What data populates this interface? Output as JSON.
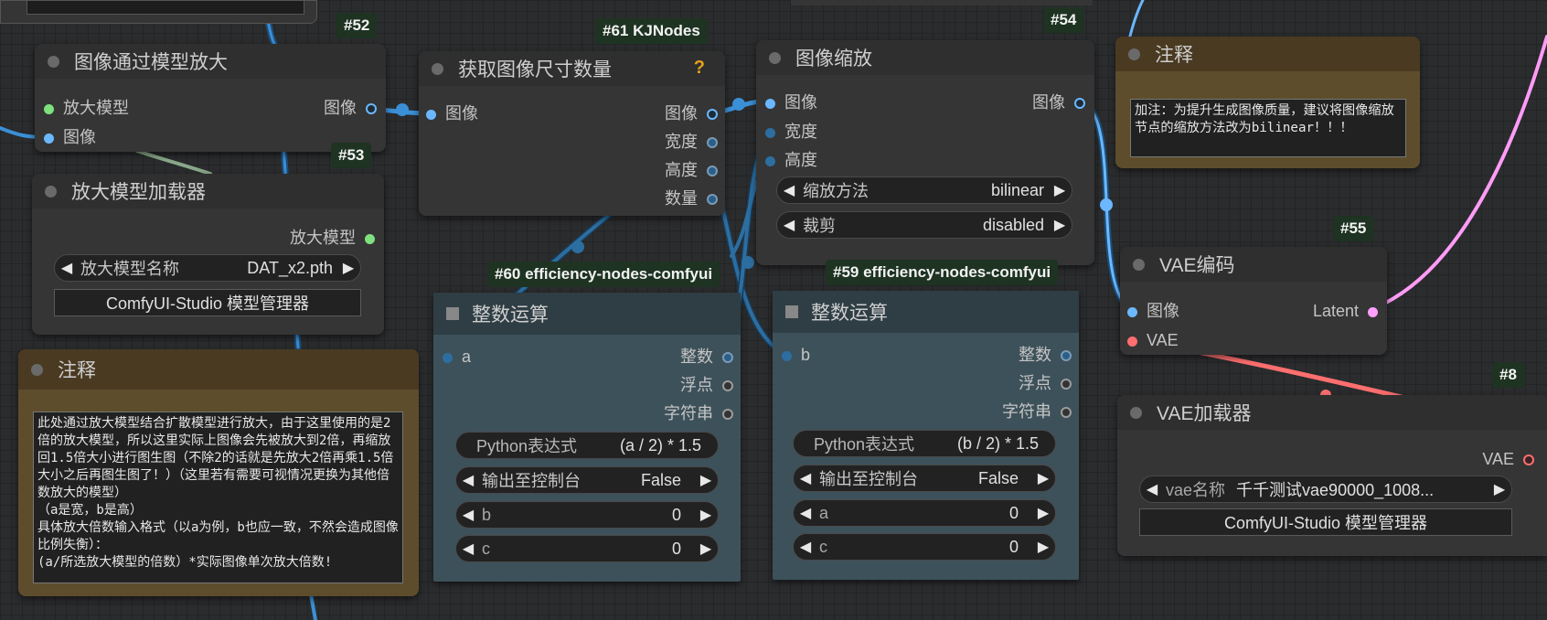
{
  "nodes": {
    "upscale_with_model": {
      "badge": "#52",
      "title": "图像通过模型放大",
      "inputs": [
        "放大模型",
        "图像"
      ],
      "outputs": [
        "图像"
      ]
    },
    "upscale_loader": {
      "badge": "#53",
      "title": "放大模型加载器",
      "outputs": [
        "放大模型"
      ],
      "widget_label": "放大模型名称",
      "widget_value": "DAT_x2.pth",
      "button": "ComfyUI-Studio 模型管理器"
    },
    "get_image_size": {
      "badge": "#61 KJNodes",
      "title": "获取图像尺寸数量",
      "help": "?",
      "inputs": [
        "图像"
      ],
      "outputs": [
        "图像",
        "宽度",
        "高度",
        "数量"
      ]
    },
    "image_scale": {
      "badge": "#54",
      "title": "图像缩放",
      "inputs": [
        "图像",
        "宽度",
        "高度"
      ],
      "outputs": [
        "图像"
      ],
      "widgets": [
        {
          "label": "缩放方法",
          "value": "bilinear"
        },
        {
          "label": "裁剪",
          "value": "disabled"
        }
      ]
    },
    "note_right": {
      "title": "注释",
      "text": "加注：为提升生成图像质量，建议将图像缩放节点的缩放方法改为bilinear！！！"
    },
    "vae_encode": {
      "badge": "#55",
      "title": "VAE编码",
      "inputs": [
        "图像",
        "VAE"
      ],
      "outputs": [
        "Latent"
      ]
    },
    "vae_loader": {
      "badge": "#8",
      "title": "VAE加载器",
      "outputs": [
        "VAE"
      ],
      "widget_label": "vae名称",
      "widget_value": "千千测试vae90000_1008...",
      "button": "ComfyUI-Studio 模型管理器"
    },
    "int_math_a": {
      "badge": "#60 efficiency-nodes-comfyui",
      "title": "整数运算",
      "inputs": [
        "a"
      ],
      "outputs": [
        "整数",
        "浮点",
        "字符串"
      ],
      "expr_label": "Python表达式",
      "expr_value": "(a / 2) * 1.5",
      "widgets": [
        {
          "label": "输出至控制台",
          "value": "False"
        },
        {
          "label": "b",
          "value": "0"
        },
        {
          "label": "c",
          "value": "0"
        }
      ]
    },
    "int_math_b": {
      "badge": "#59 efficiency-nodes-comfyui",
      "title": "整数运算",
      "inputs": [
        "b"
      ],
      "outputs": [
        "整数",
        "浮点",
        "字符串"
      ],
      "expr_label": "Python表达式",
      "expr_value": "(b / 2) * 1.5",
      "widgets": [
        {
          "label": "输出至控制台",
          "value": "False"
        },
        {
          "label": "a",
          "value": "0"
        },
        {
          "label": "c",
          "value": "0"
        }
      ]
    },
    "note_left": {
      "title": "注释",
      "text": "此处通过放大模型结合扩散模型进行放大，由于这里使用的是2倍的放大模型，所以这里实际上图像会先被放大到2倍，再缩放回1.5倍大小进行图生图（不除2的话就是先放大2倍再乘1.5倍大小之后再图生图了！）（这里若有需要可视情况更换为其他倍数放大的模型）\n（a是宽，b是高）\n具体放大倍数输入格式（以a为例，b也应一致，不然会造成图像比例失衡）：\n(a/所选放大模型的倍数）*实际图像单次放大倍数!"
    }
  },
  "colors": {
    "image": "#6bb8ff",
    "int": "#2c6ea0",
    "model": "#7ee07e",
    "vae": "#ff6f6f",
    "latent": "#ffa0ff",
    "wire_image": "#3b8fd6",
    "wire_vae": "#ff6f6f",
    "wire_latent": "#ff9cf6"
  }
}
